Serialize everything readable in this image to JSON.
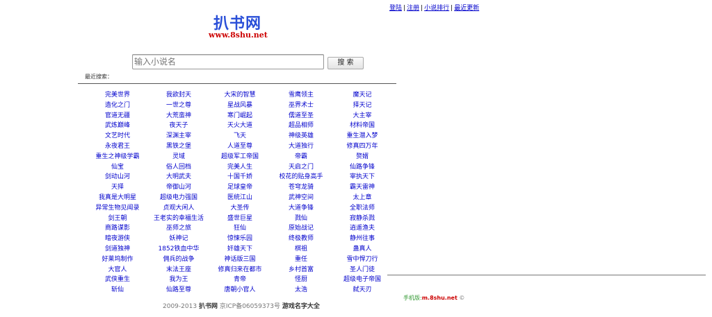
{
  "top_links": {
    "login": "登陆",
    "register": "注册",
    "ranking": "小说排行",
    "latest": "最近更新",
    "separator": "|"
  },
  "logo": {
    "title": "扒书网",
    "domain": "www.8shu.net"
  },
  "search": {
    "placeholder": "输入小说名",
    "button_label": "搜 索"
  },
  "recent_label": "最近搜索：",
  "books": [
    [
      "完美世界",
      "我欲封天",
      "大宋的智慧",
      "雪鹰领主",
      "魔天记"
    ],
    [
      "造化之门",
      "一世之尊",
      "星战风暴",
      "巫界术士",
      "择天记"
    ],
    [
      "官道无疆",
      "大荒蛮神",
      "寒门崛起",
      "儒道至圣",
      "大主宰"
    ],
    [
      "武炼巅峰",
      "夜天子",
      "天火大道",
      "超品相师",
      "材料帝国"
    ],
    [
      "文艺时代",
      "深渊主宰",
      "飞天",
      "神级英雄",
      "重生潜入梦"
    ],
    [
      "永夜君王",
      "黑铁之堡",
      "人道至尊",
      "大道独行",
      "修真四万年"
    ],
    [
      "重生之神级学霸",
      "灵域",
      "超级军工帝国",
      "帝霸",
      "赘婿"
    ],
    [
      "仙宝",
      "俗人回档",
      "完美人生",
      "天启之门",
      "仙路争锋"
    ],
    [
      "剑动山河",
      "大明武夫",
      "十国千娇",
      "校花的贴身高手",
      "宰执天下"
    ],
    [
      "天择",
      "帝御山河",
      "足球皇帝",
      "苍穹龙骑",
      "霸天雷神"
    ],
    [
      "我真是大明星",
      "超级电力强国",
      "医统江山",
      "武神空间",
      "太上章"
    ],
    [
      "异常生物见闻录",
      "贞观大闲人",
      "大圣传",
      "大道争锋",
      "全职法师"
    ],
    [
      "剑王朝",
      "王老实的幸福生活",
      "盛世巨星",
      "戮仙",
      "寂静杀戮"
    ],
    [
      "商路谋影",
      "巫师之旅",
      "狂仙",
      "原始战记",
      "逍遥渔夫"
    ],
    [
      "暗夜游侠",
      "妖神记",
      "惊悚乐园",
      "终极教师",
      "静州往事"
    ],
    [
      "剑道独神",
      "1852铁血中华",
      "奸雄天下",
      "棋祖",
      "蛊真人"
    ],
    [
      "好莱坞制作",
      "佣兵的战争",
      "神话版三国",
      "重任",
      "雪中悍刀行"
    ],
    [
      "大官人",
      "末法王座",
      "修真归来在都市",
      "乡村首富",
      "圣人门徒"
    ],
    [
      "武侠重生",
      "我为王",
      "青帝",
      "怪厨",
      "超级电子帝国"
    ],
    [
      "斩仙",
      "仙路至尊",
      "唐朝小官人",
      "太浩",
      "弑天刃"
    ]
  ],
  "footer": {
    "years": "2009-2013",
    "site": "扒书网",
    "icp": "京ICP备06059373号",
    "game_link": "游戏名字大全"
  },
  "mobile": {
    "label": "手机版:",
    "url": "m.8shu.net",
    "copyright": "©"
  }
}
